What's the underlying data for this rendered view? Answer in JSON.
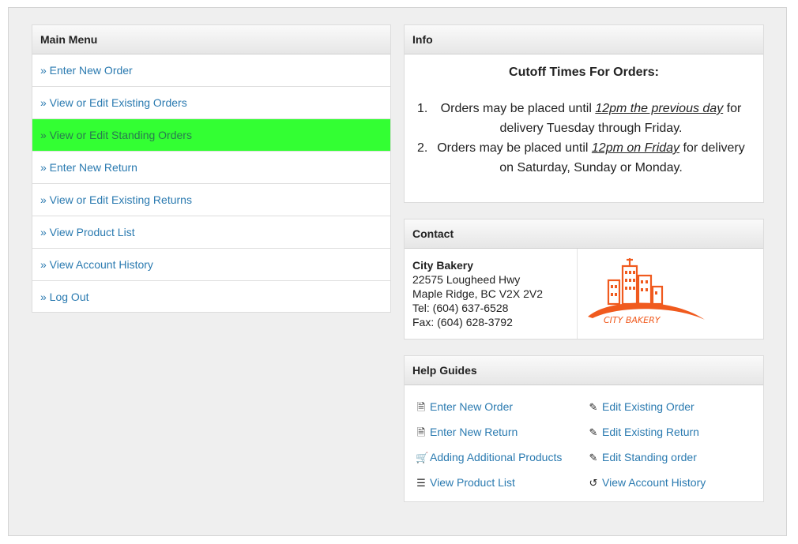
{
  "main_menu": {
    "title": "Main Menu",
    "items": [
      {
        "label": "» Enter New Order"
      },
      {
        "label": "» View or Edit Existing Orders"
      },
      {
        "label": "» View or Edit Standing Orders"
      },
      {
        "label": "» Enter New Return"
      },
      {
        "label": "» View or Edit Existing Returns"
      },
      {
        "label": "» View Product List"
      },
      {
        "label": "» View Account History"
      },
      {
        "label": "» Log Out"
      }
    ]
  },
  "info": {
    "title": "Info",
    "heading": "Cutoff Times For Orders:",
    "items": [
      {
        "num": "1.",
        "pre": "Orders may be placed until ",
        "emph": "12pm the previous day",
        "post": " for delivery Tuesday through Friday."
      },
      {
        "num": "2.",
        "pre": "Orders may be placed until ",
        "emph": "12pm on Friday",
        "post": " for delivery on Saturday, Sunday or Monday."
      }
    ]
  },
  "contact": {
    "title": "Contact",
    "name": "City Bakery",
    "address1": "22575 Lougheed Hwy",
    "address2": "Maple Ridge, BC V2X 2V2",
    "tel": "Tel: (604) 637-6528",
    "fax": "Fax: (604) 628-3792",
    "logo_text": "CITY BAKERY",
    "logo_color": "#f05a1e"
  },
  "help": {
    "title": "Help Guides",
    "links": [
      {
        "label": "Enter New Order",
        "icon": "document-icon"
      },
      {
        "label": "Edit Existing Order",
        "icon": "edit-icon"
      },
      {
        "label": "Enter New Return",
        "icon": "document-icon"
      },
      {
        "label": "Edit Existing Return",
        "icon": "edit-icon"
      },
      {
        "label": "Adding Additional Products",
        "icon": "cart-icon"
      },
      {
        "label": "Edit Standing order",
        "icon": "edit-icon"
      },
      {
        "label": "View Product List",
        "icon": "list-icon"
      },
      {
        "label": "View Account History",
        "icon": "history-icon"
      }
    ]
  },
  "colors": {
    "link": "#2a7ab0",
    "active_menu": "#33ff33",
    "brand": "#f05a1e"
  }
}
